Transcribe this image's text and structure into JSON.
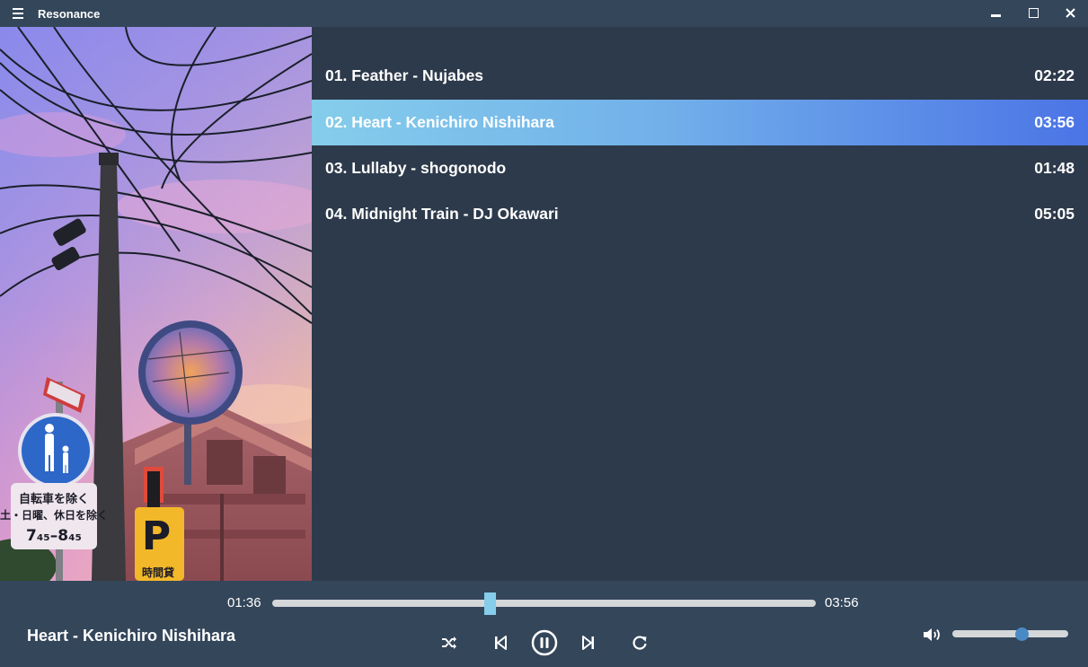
{
  "app": {
    "title": "Resonance"
  },
  "playlist": [
    {
      "label": "01. Feather - Nujabes",
      "duration": "02:22",
      "active": false
    },
    {
      "label": "02. Heart - Kenichiro Nishihara",
      "duration": "03:56",
      "active": true
    },
    {
      "label": "03. Lullaby - shogonodo",
      "duration": "01:48",
      "active": false
    },
    {
      "label": "04. Midnight Train - DJ Okawari",
      "duration": "05:05",
      "active": false
    }
  ],
  "player": {
    "now_playing": "Heart - Kenichiro Nishihara",
    "current_time": "01:36",
    "total_time": "03:56",
    "progress_fraction": 0.4,
    "volume_fraction": 0.6
  },
  "album_art": {
    "sign_line1": "自転車を除く",
    "sign_line2": "土・日曜、休日を除く",
    "sign_line3": "7₄₅–8₄₅",
    "parking_letter": "P",
    "parking_text": "時間貸"
  },
  "icons": {
    "menu": "menu-icon",
    "minimize": "minimize-icon",
    "maximize": "maximize-icon",
    "close": "close-icon",
    "shuffle": "shuffle-icon",
    "previous": "skip-previous-icon",
    "pause": "pause-icon",
    "next": "skip-next-icon",
    "repeat": "repeat-icon",
    "volume": "volume-icon"
  },
  "colors": {
    "background": "#2d3a4b",
    "bar": "#34465a",
    "active_gradient_start": "#85cdeb",
    "active_gradient_end": "#4b74e6",
    "seek_thumb": "#85cdeb",
    "volume_thumb": "#4a8ac4"
  }
}
